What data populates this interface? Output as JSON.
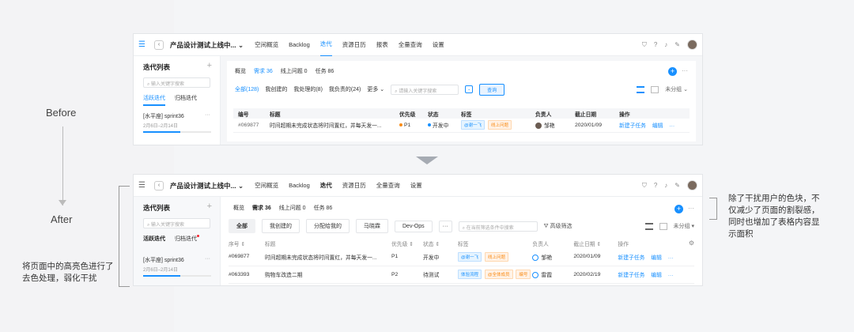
{
  "labels": {
    "before": "Before",
    "after": "After"
  },
  "notes": {
    "left": [
      "将页面中的高亮色进行了",
      "去色处理，弱化干扰"
    ],
    "right": [
      "除了干扰用户的色块，不",
      "仅减少了页面的割裂感，",
      "同时也增加了表格内容显",
      "示面积"
    ]
  },
  "before": {
    "project": "产品设计测试上线中...",
    "nav": [
      "空间概览",
      "Backlog",
      "迭代",
      "资源日历",
      "报表",
      "全量查询",
      "设置"
    ],
    "nav_active": 2,
    "sidebar": {
      "title": "迭代列表",
      "search_placeholder": "输入关键字搜索",
      "tabs": [
        "活跃迭代",
        "归档迭代"
      ],
      "sprint_name": "[水平座] sprint36",
      "sprint_date": "2月6日–2月14日",
      "progress": 0.55
    },
    "tabs": [
      "概览",
      "需求 36",
      "线上问题 0",
      "任务 86"
    ],
    "filters": [
      "全部(128)",
      "我创建的",
      "我处理的(8)",
      "我负责的(24)",
      "更多"
    ],
    "search_placeholder": "请输入关键字搜索",
    "query_label": "查询",
    "group_label": "未分组",
    "columns": [
      "编号",
      "标题",
      "优先级",
      "状态",
      "标签",
      "负责人",
      "截止日期",
      "操作"
    ],
    "rows": [
      {
        "id": "#069877",
        "title": "时间超期未完成状态将时间置红，并每天发一...",
        "priority": "P1",
        "status": "开发中",
        "tags": [
          "@谢一飞",
          "线上问题"
        ],
        "owner": "邹艳",
        "due": "2020/01/09",
        "action": "新建子任务",
        "edit": "编辑"
      }
    ]
  },
  "after": {
    "project": "产品设计测试上线中...",
    "nav": [
      "空间概览",
      "Backlog",
      "迭代",
      "资源日历",
      "全量查询",
      "设置"
    ],
    "nav_active": 2,
    "sidebar": {
      "title": "迭代列表",
      "search_placeholder": "输入关键字搜索",
      "tabs": [
        "活跃迭代",
        "归档迭代"
      ],
      "sprint_name": "[水平座] sprint36",
      "sprint_date": "2月6日–2月14日",
      "progress": 0.55
    },
    "tabs": [
      "概览",
      "需求 36",
      "线上问题 0",
      "任务 86"
    ],
    "filters": [
      "全部",
      "我创建的",
      "分配给我的",
      "马晓霖",
      "Dev-Ops"
    ],
    "search_placeholder": "在当前筛选条件中搜索",
    "adv_filter": "高级筛选",
    "group_label": "未分组",
    "columns": [
      "序号",
      "标题",
      "优先级",
      "状态",
      "标签",
      "负责人",
      "截止日期",
      "操作"
    ],
    "rows": [
      {
        "id": "#069877",
        "title": "时间超期未完成状态将时间置红，并每天发一...",
        "priority": "P1",
        "status": "开发中",
        "tags": [
          "@谢一飞",
          "线上问题"
        ],
        "owner": "邹艳",
        "due": "2020/01/09",
        "action": "新建子任务",
        "edit": "编辑"
      },
      {
        "id": "#063393",
        "title": "购物车改造二期",
        "priority": "P2",
        "status": "待测试",
        "tags": [
          "体验流程",
          "@全体成员",
          "编号"
        ],
        "owner": "雷霞",
        "due": "2020/02/19",
        "action": "新建子任务",
        "edit": "编辑"
      }
    ]
  }
}
